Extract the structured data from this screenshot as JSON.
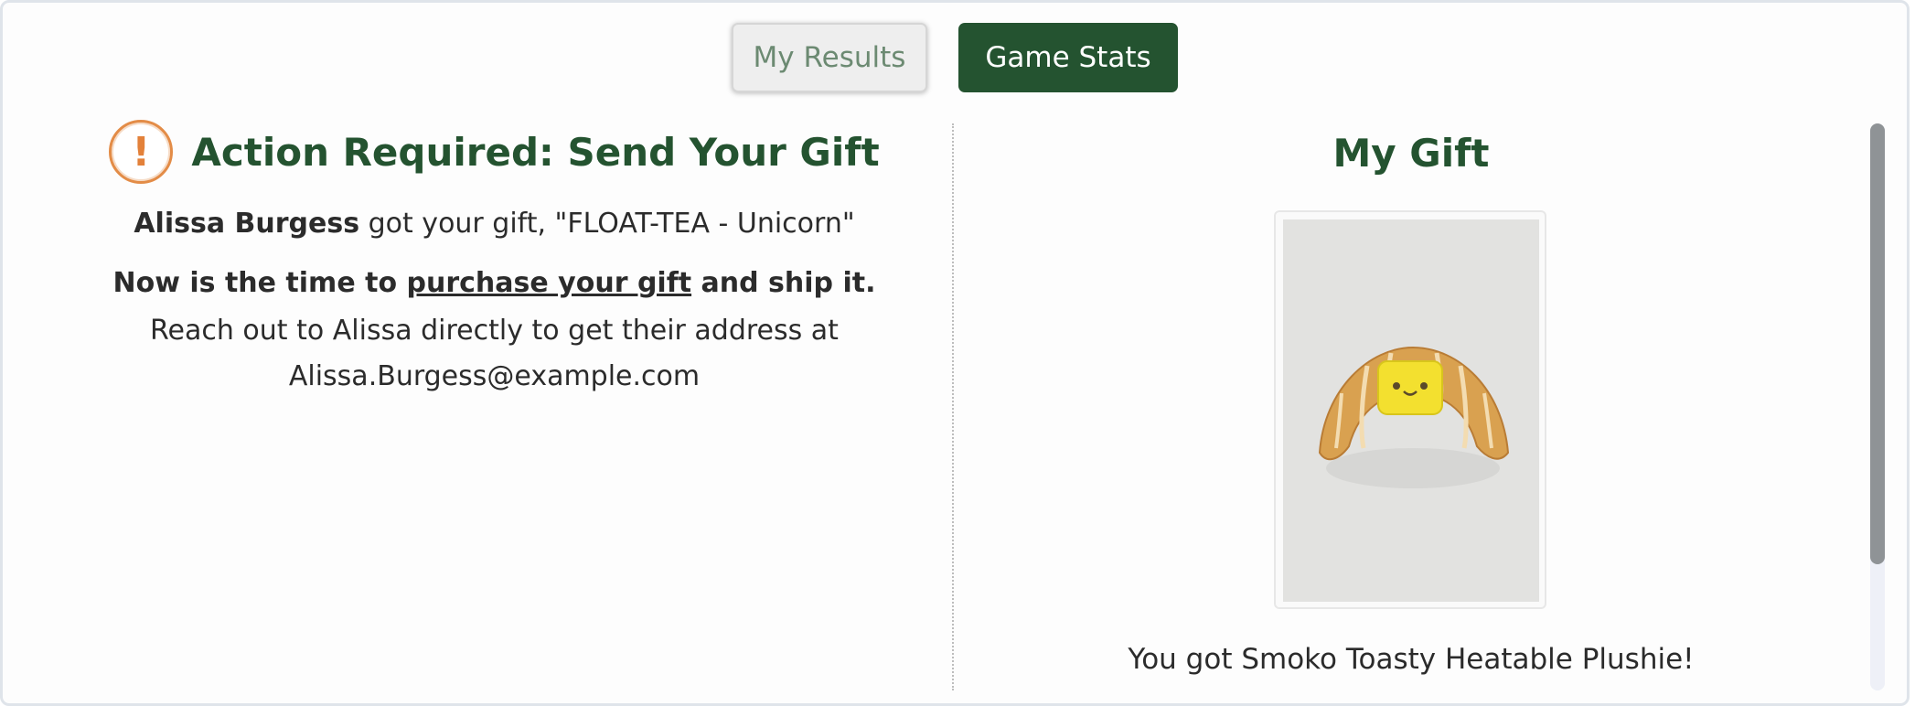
{
  "tabs": {
    "results_label": "My Results",
    "stats_label": "Game Stats"
  },
  "action": {
    "icon": "exclamation-circle-icon",
    "title": "Action Required: Send Your Gift",
    "recipient_name": "Alissa Burgess",
    "received_text": " got your gift, \"FLOAT-TEA - Unicorn\"",
    "instruction_prefix": "Now is the time to ",
    "instruction_link": "purchase your gift",
    "instruction_suffix": " and ship it.",
    "contact_text": "Reach out to Alissa directly to get their address at",
    "contact_email": "Alissa.Burgess@example.com"
  },
  "gift": {
    "title": "My Gift",
    "caption": "You got Smoko Toasty Heatable Plushie!"
  },
  "colors": {
    "brand_green": "#245330",
    "alert_orange": "#e38c47"
  }
}
